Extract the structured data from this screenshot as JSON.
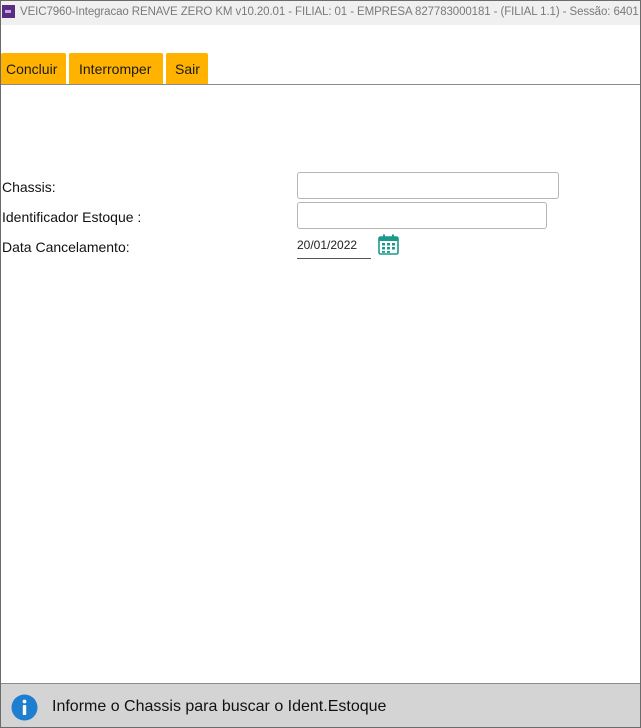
{
  "window": {
    "title": "VEIC7960-Integracao RENAVE ZERO KM v10.20.01   - FILIAL: 01 - EMPRESA 827783000181 - (FILIAL 1.1) - Sessão: 6401"
  },
  "toolbar": {
    "concluir_label": "Concluir",
    "interromper_label": "Interromper",
    "sair_label": "Sair",
    "button_color": "#ffb300"
  },
  "form": {
    "chassis_label": "Chassis:",
    "chassis_value": "",
    "identificador_label": "Identificador Estoque :",
    "identificador_value": "",
    "data_label": "Data Cancelamento:",
    "data_value": "20/01/2022"
  },
  "status": {
    "message": "Informe o Chassis para buscar o Ident.Estoque",
    "icon": "info-icon"
  },
  "colors": {
    "calendar_icon": "#1a9a8a",
    "info_icon": "#1e7fd0"
  }
}
